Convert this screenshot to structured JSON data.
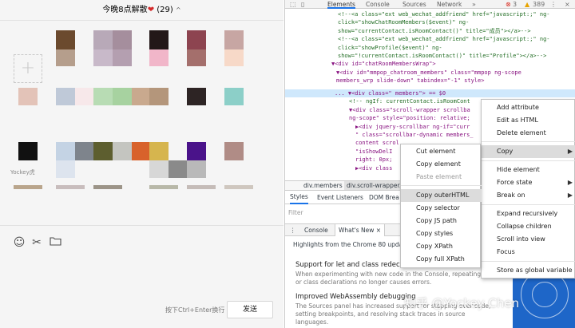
{
  "chat": {
    "title_prefix": "今晚8点解散",
    "title_emoji": "❤",
    "member_count": "(29)",
    "title_chevron": "^",
    "add_icon": "plus-icon",
    "member_name": "Yockey虎",
    "tools": [
      "emoji-icon",
      "scissors-icon",
      "folder-icon"
    ],
    "send_hint": "按下Ctrl+Enter换行",
    "send_label": "发送"
  },
  "devtools": {
    "tabs": [
      "Elements",
      "Console",
      "Sources",
      "Network"
    ],
    "errors": "3",
    "warnings": "389",
    "code_lines": [
      "<!--<a class=\"ext web_wechat_addfriend\" href=\"javascript:;\" ng-",
      "click=\"showChatRoomMembers($event)\" ng-",
      "show=\"currentContact.isRoomContact()\" title=\"成员\"></a>-->",
      "<!--<a class=\"ext web_wechat_addfriend\" href=\"javascript:;\" ng-",
      "click=\"showProfile($event)\" ng-",
      "show=\"!currentContact.isRoomContact()\" title=\"Profile\"></a>-->",
      "▼<div id=\"chatRoomMembersWrap\">",
      "  ▼<div id=\"mmpop_chatroom_members\" class=\"mmpop ng-scope",
      "  members_wrp slide-down\" tabindex=\"-1\" style>",
      "...  ▼<div class=\" members\"> == $0",
      "        <!-- ngIf: currentContact.isRoomCont",
      "      ▼<div class=\"scroll-wrapper scrollba",
      "      ng-scope\" style=\"position: relative;",
      "        ▶<div jquery-scrollbar ng-if=\"curr",
      "        \" class=\"scrollbar-dynamic members_",
      "        content scrol",
      "        \"isShowDelI",
      "        right: 0px;",
      "        ▶<div class"
    ],
    "breadcrumb": [
      "div.members",
      "div.scroll-wrapper..."
    ],
    "styles_tabs": [
      "Styles",
      "Event Listeners",
      "DOM Brea"
    ],
    "filter_placeholder": "Filter",
    "drawer_tabs": [
      "Console",
      "What's New ×"
    ],
    "whatsnew": {
      "highlights": "Highlights from the Chrome 80 update",
      "h1": "Support for let and class redeclarations",
      "t1a": "When experimenting with new code in the Console, repeating let",
      "t1b": "or class declarations no longer causes errors.",
      "h2": "Improved WebAssembly debugging",
      "t2a": "The Sources panel has increased support for stepping over code,",
      "t2b": "setting breakpoints, and resolving stack traces in source",
      "t2c": "languages."
    },
    "watermark": "知乎 @Yockey Chen"
  },
  "context_menu": {
    "items": [
      "Add attribute",
      "Edit as HTML",
      "Delete element",
      "Copy",
      "Hide element",
      "Force state",
      "Break on",
      "Expand recursively",
      "Collapse children",
      "Scroll into view",
      "Focus",
      "Store as global variable"
    ]
  },
  "copy_submenu": {
    "items": [
      "Cut element",
      "Copy element",
      "Paste element",
      "Copy outerHTML",
      "Copy selector",
      "Copy JS path",
      "Copy styles",
      "Copy XPath",
      "Copy full XPath"
    ]
  },
  "colors": {
    "selection": "#cfe8fc",
    "accent": "#1a73e8",
    "menu_highlight": "#dcdcdc"
  }
}
